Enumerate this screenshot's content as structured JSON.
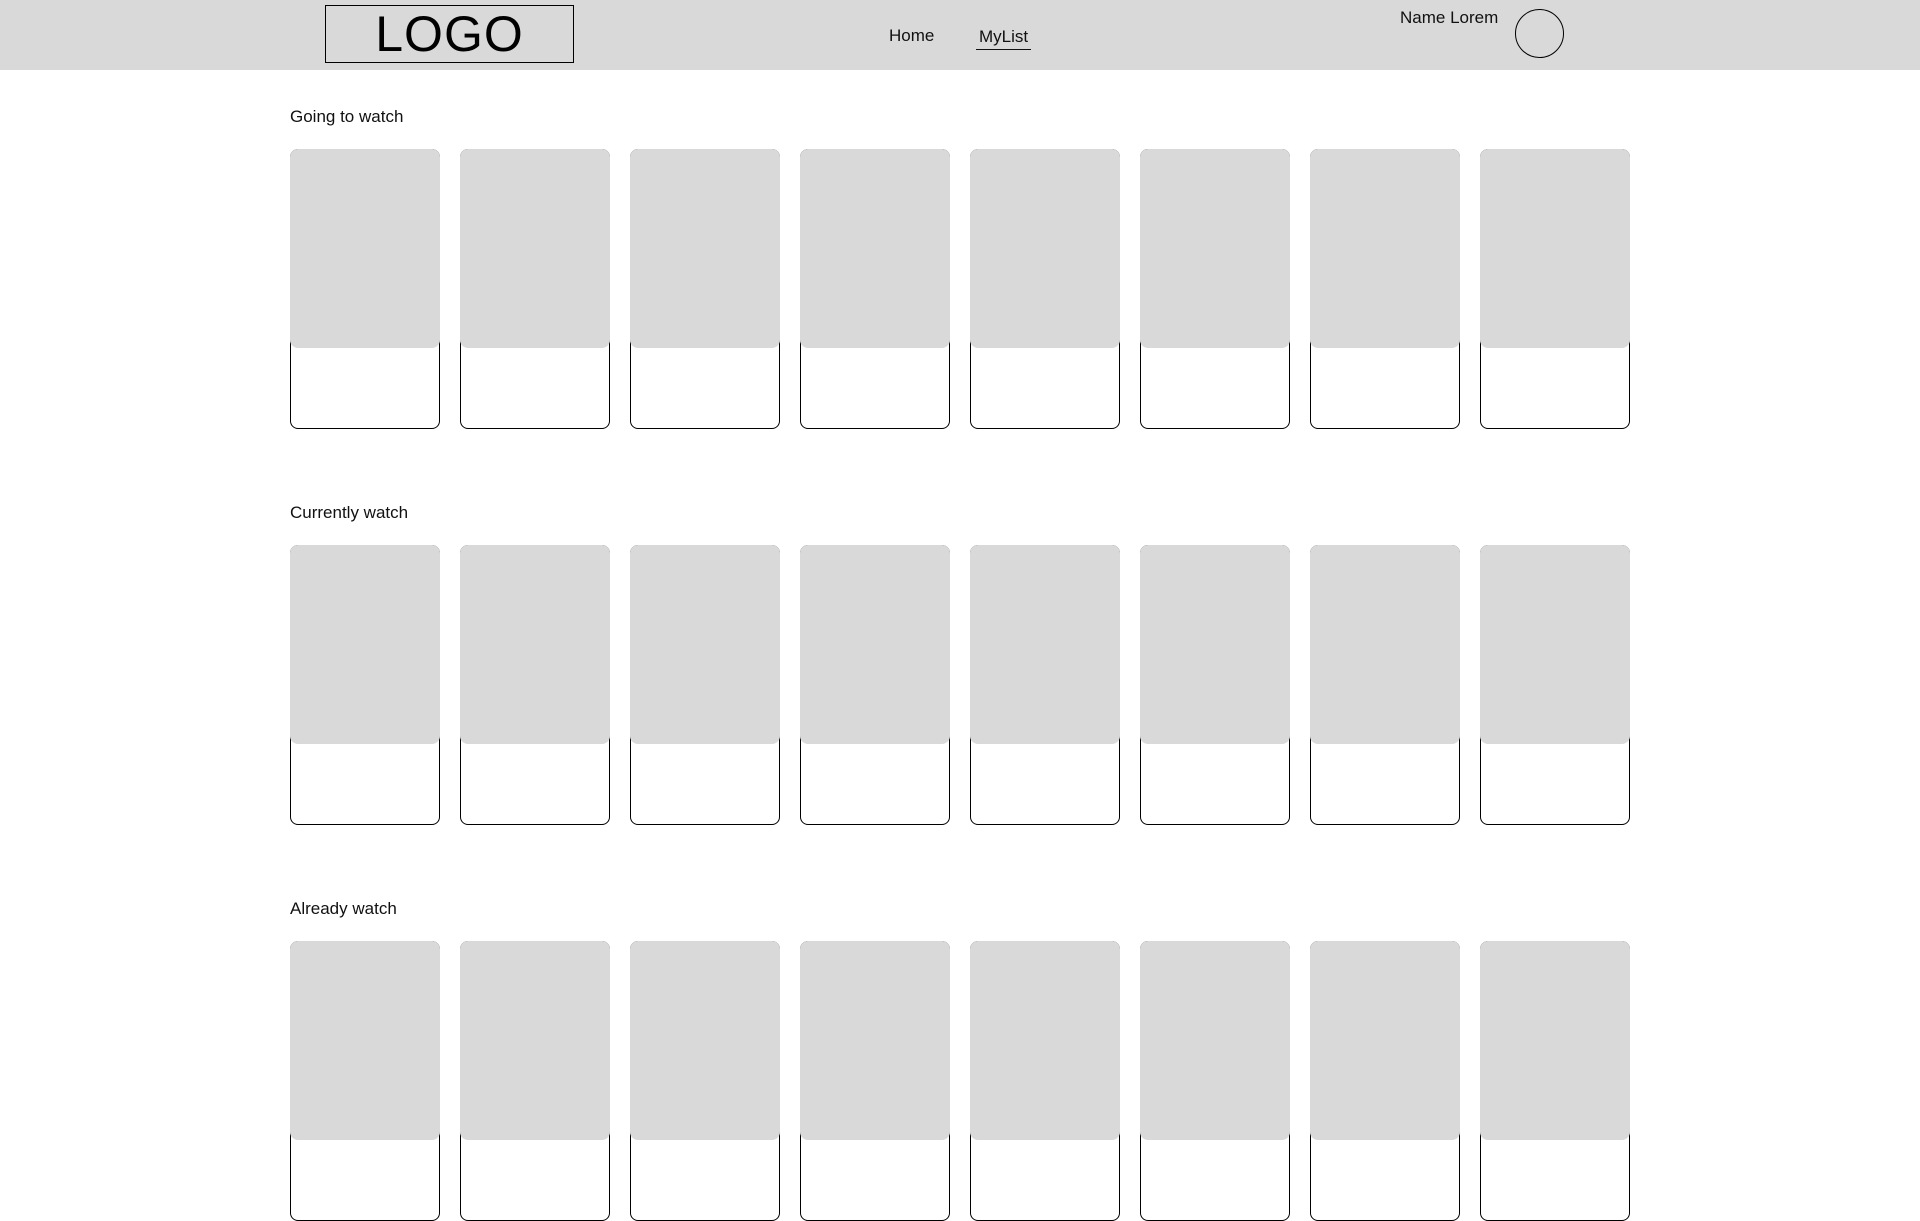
{
  "header": {
    "logo_text": "LOGO",
    "nav": {
      "home": "Home",
      "mylist": "MyList"
    },
    "user": {
      "name": "Name Lorem"
    }
  },
  "sections": [
    {
      "title": "Going to watch",
      "cards": 8
    },
    {
      "title": "Currently watch",
      "cards": 8
    },
    {
      "title": "Already watch",
      "cards": 8
    }
  ],
  "colors": {
    "header_bg": "#d9d9d9",
    "poster_placeholder": "#d9d9d9",
    "border": "#000000"
  }
}
